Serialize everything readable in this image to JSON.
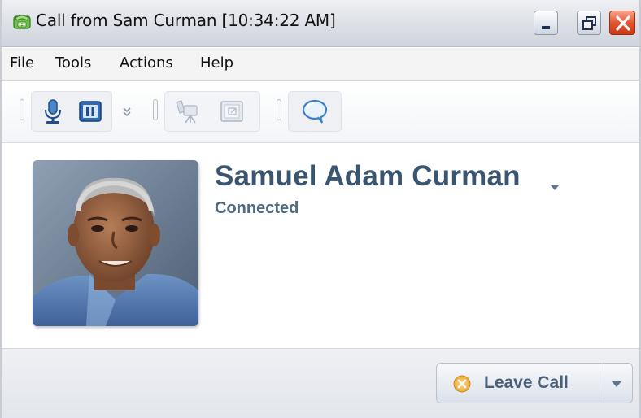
{
  "window": {
    "title": "Call from Sam Curman [10:34:22 AM]",
    "title_icon": "phone-icon",
    "controls": [
      "minimize-icon",
      "restore-icon",
      "close-icon"
    ]
  },
  "menu": {
    "items": [
      {
        "label": "File"
      },
      {
        "label": "Tools"
      },
      {
        "label": "Actions"
      },
      {
        "label": "Help"
      }
    ]
  },
  "toolbar": {
    "buttons": [
      {
        "icon": "microphone-icon",
        "enabled": true
      },
      {
        "icon": "pause-icon",
        "enabled": true
      },
      {
        "icon": "chevron-double-down-icon",
        "enabled": true
      },
      {
        "icon": "video-camera-icon",
        "enabled": false
      },
      {
        "icon": "screen-share-icon",
        "enabled": false
      },
      {
        "icon": "chat-bubble-icon",
        "enabled": true
      }
    ]
  },
  "contact": {
    "name": "Samuel Adam Curman",
    "status": "Connected",
    "avatar": "contact-photo"
  },
  "footer": {
    "leave_call_label": "Leave Call",
    "leave_call_icon": "leave-call-icon"
  },
  "colors": {
    "name_text": "#3a556f",
    "status_text": "#4d6984",
    "close_button": "#d94a26",
    "leave_icon": "#e8a436"
  }
}
